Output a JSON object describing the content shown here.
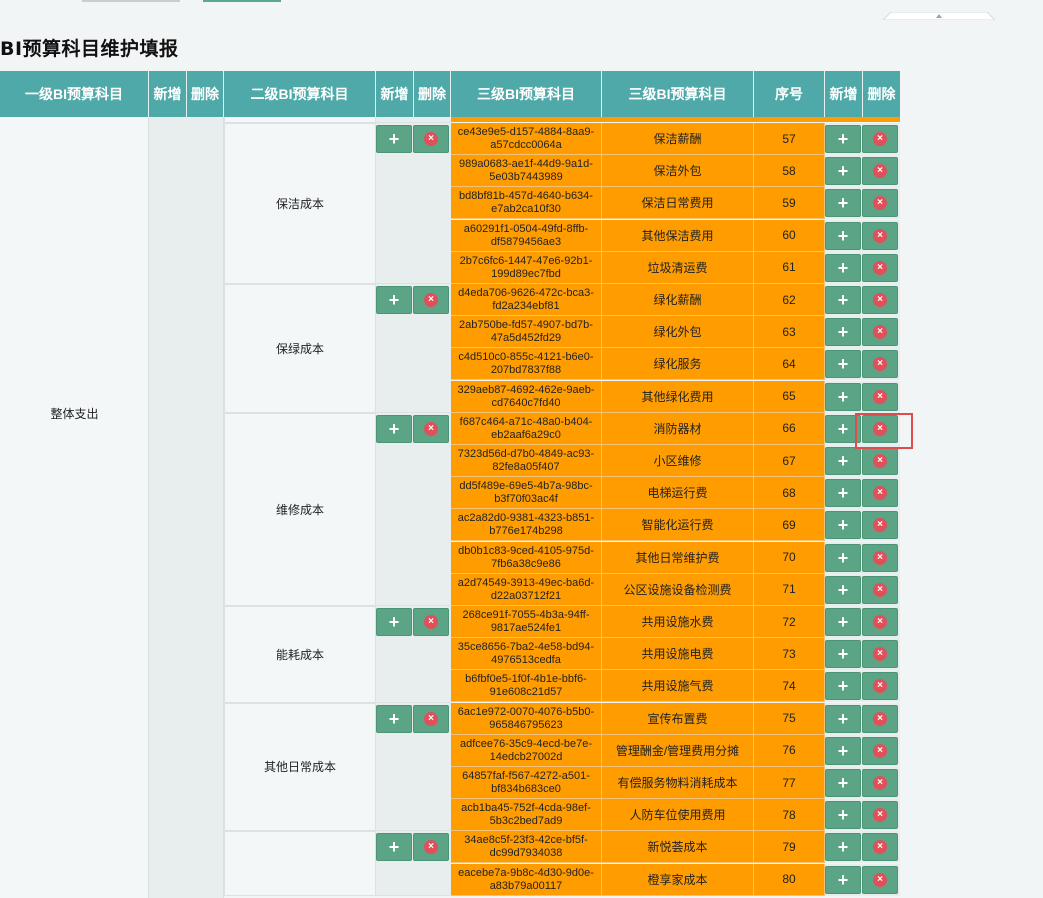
{
  "page_title": "BI预算科目维护填报",
  "headers": {
    "l1": "一级BI预算科目",
    "add1": "新增",
    "del1": "删除",
    "l2": "二级BI预算科目",
    "add2": "新增",
    "del2": "删除",
    "l3_id": "三级BI预算科目",
    "l3_name": "三级BI预算科目",
    "seq": "序号",
    "add3": "新增",
    "del3": "删除"
  },
  "level1": {
    "label": "整体支出"
  },
  "level2": [
    {
      "label": "保洁成本"
    },
    {
      "label": "保绿成本"
    },
    {
      "label": "维修成本"
    },
    {
      "label": "能耗成本"
    },
    {
      "label": "其他日常成本"
    }
  ],
  "rows": [
    {
      "id": "ce43e9e5-d157-4884-8aa9-a57cdcc0064a",
      "name": "保洁薪酬",
      "seq": "57"
    },
    {
      "id": "989a0683-ae1f-44d9-9a1d-5e03b7443989",
      "name": "保洁外包",
      "seq": "58"
    },
    {
      "id": "bd8bf81b-457d-4640-b634-e7ab2ca10f30",
      "name": "保洁日常费用",
      "seq": "59"
    },
    {
      "id": "a60291f1-0504-49fd-8ffb-df5879456ae3",
      "name": "其他保洁费用",
      "seq": "60"
    },
    {
      "id": "2b7c6fc6-1447-47e6-92b1-199d89ec7fbd",
      "name": "垃圾清运费",
      "seq": "61"
    },
    {
      "id": "d4eda706-9626-472c-bca3-fd2a234ebf81",
      "name": "绿化薪酬",
      "seq": "62"
    },
    {
      "id": "2ab750be-fd57-4907-bd7b-47a5d452fd29",
      "name": "绿化外包",
      "seq": "63"
    },
    {
      "id": "c4d510c0-855c-4121-b6e0-207bd7837f88",
      "name": "绿化服务",
      "seq": "64"
    },
    {
      "id": "329aeb87-4692-462e-9aeb-cd7640c7fd40",
      "name": "其他绿化费用",
      "seq": "65"
    },
    {
      "id": "f687c464-a71c-48a0-b404-eb2aaf6a29c0",
      "name": "消防器材",
      "seq": "66"
    },
    {
      "id": "7323d56d-d7b0-4849-ac93-82fe8a05f407",
      "name": "小区维修",
      "seq": "67"
    },
    {
      "id": "dd5f489e-69e5-4b7a-98bc-b3f70f03ac4f",
      "name": "电梯运行费",
      "seq": "68"
    },
    {
      "id": "ac2a82d0-9381-4323-b851-b776e174b298",
      "name": "智能化运行费",
      "seq": "69"
    },
    {
      "id": "db0b1c83-9ced-4105-975d-7fb6a38c9e86",
      "name": "其他日常维护费",
      "seq": "70"
    },
    {
      "id": "a2d74549-3913-49ec-ba6d-d22a03712f21",
      "name": "公区设施设备检测费",
      "seq": "71"
    },
    {
      "id": "268ce91f-7055-4b3a-94ff-9817ae524fe1",
      "name": "共用设施水费",
      "seq": "72"
    },
    {
      "id": "35ce8656-7ba2-4e58-bd94-4976513cedfa",
      "name": "共用设施电费",
      "seq": "73"
    },
    {
      "id": "b6fbf0e5-1f0f-4b1e-bbf6-91e608c21d57",
      "name": "共用设施气费",
      "seq": "74"
    },
    {
      "id": "6ac1e972-0070-4076-b5b0-965846795623",
      "name": "宣传布置费",
      "seq": "75"
    },
    {
      "id": "adfcee76-35c9-4ecd-be7e-14edcb27002d",
      "name": "管理酬金/管理费用分摊",
      "seq": "76"
    },
    {
      "id": "64857faf-f567-4272-a501-bf834b683ce0",
      "name": "有偿服务物料消耗成本",
      "seq": "77"
    },
    {
      "id": "acb1ba45-752f-4cda-98ef-5b3c2bed7ad9",
      "name": "人防车位使用费用",
      "seq": "78"
    },
    {
      "id": "34ae8c5f-23f3-42ce-bf5f-dc99d7934038",
      "name": "新悦荟成本",
      "seq": "79"
    },
    {
      "id": "eacebe7a-9b8c-4d30-9d0e-a83b79a00117",
      "name": "橙享家成本",
      "seq": "80"
    }
  ],
  "icons": {
    "add": "plus-icon",
    "delete": "close-circle-icon"
  },
  "colors": {
    "header": "#4fa9a8",
    "row_highlight": "#ff9d00",
    "button": "#5ba586",
    "delete_icon": "#e0505a",
    "focus_box": "#e04b4b"
  }
}
